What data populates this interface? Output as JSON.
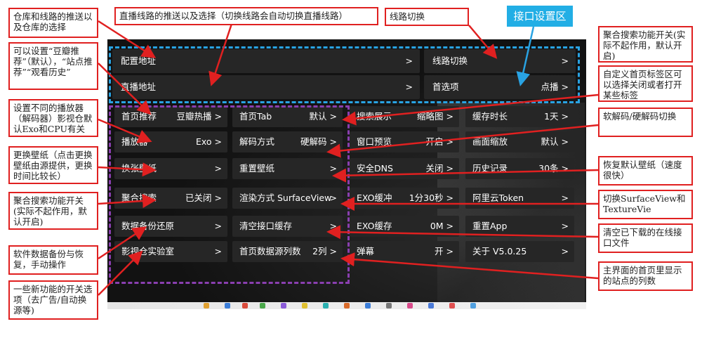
{
  "iface_label": "接口设置区",
  "rows": {
    "config": {
      "label": "配置地址",
      "value": ">"
    },
    "line": {
      "label": "线路切换",
      "value": ">"
    },
    "live": {
      "label": "直播地址",
      "value": ">"
    },
    "home": {
      "label": "首选项",
      "value": "点播 >"
    }
  },
  "grid": [
    [
      {
        "label": "首页推荐",
        "value": "豆瓣热播 >"
      },
      {
        "label": "首页Tab",
        "value": "默认 >"
      },
      {
        "label": "搜索展示",
        "value": "缩略图 >"
      },
      {
        "label": "缓存时长",
        "value": "1天 >"
      }
    ],
    [
      {
        "label": "播放器",
        "value": "Exo >"
      },
      {
        "label": "解码方式",
        "value": "硬解码 >"
      },
      {
        "label": "窗口预览",
        "value": "开启 >"
      },
      {
        "label": "画面缩放",
        "value": "默认 >"
      }
    ],
    [
      {
        "label": "换张壁纸",
        "value": ">"
      },
      {
        "label": "重置壁纸",
        "value": ">"
      },
      {
        "label": "安全DNS",
        "value": "关闭 >"
      },
      {
        "label": "历史记录",
        "value": "30条 >"
      }
    ],
    [
      {
        "label": "聚合搜索",
        "value": "已关闭 >"
      },
      {
        "label": "渲染方式 SurfaceView",
        "value": ">"
      },
      {
        "label": "EXO缓冲",
        "value": "1分30秒 >"
      },
      {
        "label": "阿里云Token",
        "value": ">"
      }
    ],
    [
      {
        "label": "数据备份还原",
        "value": ">"
      },
      {
        "label": "清空接口缓存",
        "value": ">"
      },
      {
        "label": "EXO缓存",
        "value": "0M >"
      },
      {
        "label": "重置App",
        "value": ">"
      }
    ],
    [
      {
        "label": "影视仓实验室",
        "value": ">"
      },
      {
        "label": "首页数据源列数",
        "value": "2列 >"
      },
      {
        "label": "弹幕",
        "value": "开 >"
      },
      {
        "label": "关于 V5.0.25",
        "value": ">"
      }
    ]
  ],
  "annotations": {
    "a1": "仓库和线路的推送以及仓库的选择",
    "a2": "直播线路的推送以及选择（切换线路会自动切换直播线路）",
    "a3": "线路切换",
    "a4": "聚合搜索功能开关(实际不起作用，默认开启)",
    "a5": "可以设置“豆瓣推荐”（默认），“站点推荐”“观看历史”",
    "a6": "自定义首页标签区可以选择关闭或者打开某些标签",
    "a7": "设置不同的播放器（解码器）影视仓默认Exo和CPU有关",
    "a8": "软解码/硬解码切换",
    "a9": "更换壁纸（点击更换壁纸由源提供，更换时间比较长）",
    "a10": "恢复默认壁纸（速度很快）",
    "a11": "聚合搜索功能开关(实际不起作用，默认开启)",
    "a12": "切换SurfaceView和TextureVie",
    "a13": "清空已下载的在线接口文件",
    "a14": "软件数据备份与恢复，手动操作",
    "a15": "主界面的首页里显示的站点的列数",
    "a16": "一些新功能的开关选项（去广告/自动换源等)"
  }
}
